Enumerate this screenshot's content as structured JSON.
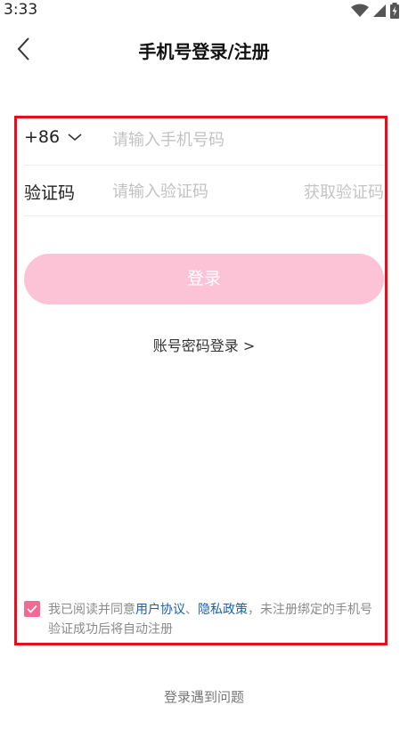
{
  "status_bar": {
    "time": "3:33",
    "icons": [
      "wifi-icon",
      "signal-icon",
      "battery-charging-icon"
    ]
  },
  "header": {
    "title": "手机号登录/注册",
    "back_icon": "chevron-left-icon"
  },
  "form": {
    "country_code": "+86",
    "phone_placeholder": "请输入手机号码",
    "phone_value": "",
    "code_label": "验证码",
    "code_placeholder": "请输入验证码",
    "code_value": "",
    "get_code_label": "获取验证码",
    "login_label": "登录",
    "account_login_label": "账号密码登录 >"
  },
  "agreement": {
    "checked": true,
    "text_prefix": "我已阅读并同意",
    "user_agreement": "用户协议",
    "separator": "、",
    "privacy_policy": "隐私政策",
    "text_suffix": "，未注册绑定的手机号验证成功后将自动注册"
  },
  "footer": {
    "help_label": "登录遇到问题"
  },
  "colors": {
    "accent_pink": "#fcc2d5",
    "checkbox_pink": "#f26a93",
    "link_blue": "#1a5fa8",
    "highlight_red": "#e3101c"
  }
}
